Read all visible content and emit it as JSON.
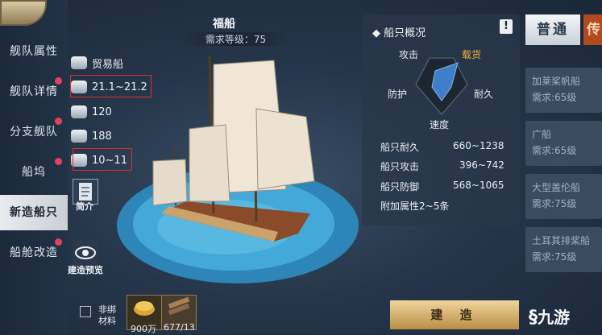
{
  "nav": {
    "items": [
      {
        "label": "舰队属性",
        "dot": false
      },
      {
        "label": "舰队详情",
        "dot": true
      },
      {
        "label": "分支舰队",
        "dot": true
      },
      {
        "label": "船坞",
        "dot": true
      },
      {
        "label": "新造船只",
        "dot": false
      },
      {
        "label": "船舱改造",
        "dot": true
      }
    ]
  },
  "ship": {
    "name": "福船",
    "requirement": "需求等级：75",
    "type": "贸易船",
    "stat1": "21.1~21.2",
    "stat2": "120",
    "stat3": "188",
    "stat4": "10~11"
  },
  "buttons": {
    "intro": "简介",
    "preview": "建造预览",
    "build": "建 造"
  },
  "overview": {
    "title": "船只概况",
    "info": "!",
    "radar": {
      "attack": "攻击",
      "cargo": "载货",
      "defense": "防护",
      "durability": "耐久",
      "speed": "速度"
    },
    "rows": [
      {
        "label": "船只耐久",
        "value": "660~1238"
      },
      {
        "label": "船只攻击",
        "value": "396~742"
      },
      {
        "label": "船只防御",
        "value": "568~1065"
      }
    ],
    "extra": "附加属性2~5条"
  },
  "tabs": {
    "normal": "普通",
    "other": "传"
  },
  "list": [
    {
      "name": "加莱桨帆船",
      "req": "需求:65级"
    },
    {
      "name": "广船",
      "req": "需求:65级"
    },
    {
      "name": "大型盖伦船",
      "req": "需求:75级"
    },
    {
      "name": "土耳其排桨船",
      "req": "需求:75级"
    }
  ],
  "bottom": {
    "unbound_line1": "非绑",
    "unbound_line2": "材料",
    "gold": "900万",
    "wood": "677/13"
  },
  "watermark": "九游",
  "colors": {
    "highlight": "#e02d2d",
    "cargo": "#f0b13c",
    "radar": "#3f7fc9",
    "water": "#39a4d6"
  }
}
